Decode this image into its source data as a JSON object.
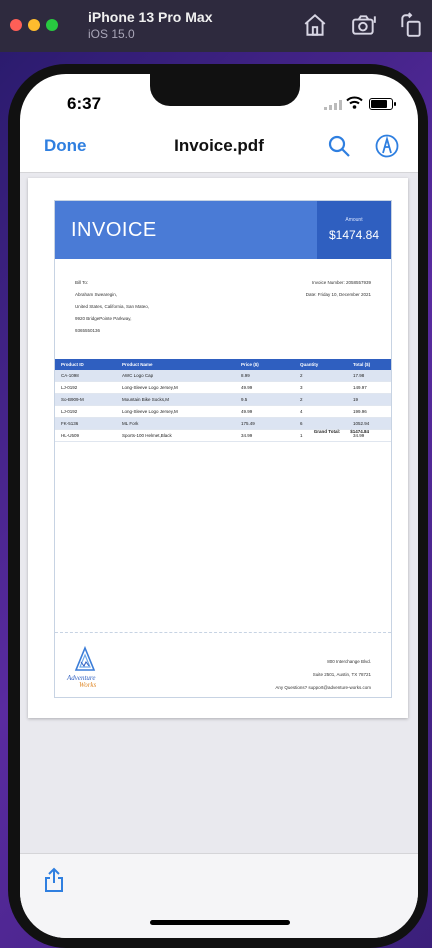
{
  "simulator": {
    "device_name": "iPhone 13 Pro Max",
    "os_version": "iOS 15.0"
  },
  "status_bar": {
    "time": "6:37"
  },
  "nav": {
    "done_label": "Done",
    "title": "Invoice.pdf"
  },
  "invoice": {
    "title": "INVOICE",
    "amount_label": "Amount",
    "amount_value": "$1474.84",
    "bill_to": [
      "Bill To:",
      "Abraham Swearegin,",
      "United States, California, San Mateo,",
      "9920 BridgePointe Parkway,",
      "9365550136"
    ],
    "meta": [
      "Invoice Number: 2058557939",
      "Date: Friday 10, December 2021"
    ],
    "table": {
      "headers": [
        "Product ID",
        "Product Name",
        "Price ($)",
        "Quantity",
        "Total ($)"
      ],
      "rows": [
        [
          "CA-1098",
          "AWC Logo Cap",
          "8.99",
          "2",
          "17.98"
        ],
        [
          "LJ-0192",
          "Long-Sleeve Logo Jersey,M",
          "49.99",
          "3",
          "149.97"
        ],
        [
          "So-B909-M",
          "Mountain Bike Socks,M",
          "9.5",
          "2",
          "19"
        ],
        [
          "LJ-0192",
          "Long-Sleeve Logo Jersey,M",
          "49.99",
          "4",
          "199.96"
        ],
        [
          "FK-5136",
          "ML Fork",
          "175.49",
          "6",
          "1052.94"
        ],
        [
          "HL-U509",
          "Sports-100 Helmet,Black",
          "34.99",
          "1",
          "34.99"
        ]
      ]
    },
    "grand_total_label": "Grand Total:",
    "grand_total_value": "$1474.84",
    "logo_text": "Adventure Works",
    "footer": [
      "800 Interchange Blvd.",
      "Suite 2501,  Austin, TX 78721",
      "Any Questions? support@adventure-works.com"
    ]
  },
  "icons": {
    "sim_home": "home-icon",
    "sim_screenshot": "screenshot-icon",
    "sim_rotate": "rotate-icon",
    "search": "search-icon",
    "markup": "markup-pen-icon",
    "share": "share-icon"
  },
  "colors": {
    "accent": "#2f7fe0",
    "invoice_header": "#4a7bd6",
    "invoice_dark": "#2f5fc0",
    "row_alt": "#dce4f2"
  }
}
